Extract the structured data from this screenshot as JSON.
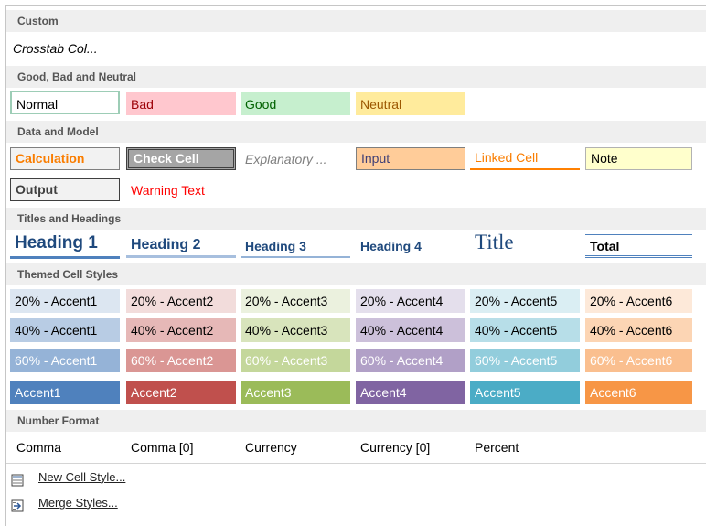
{
  "sections": {
    "custom": "Custom",
    "good_bad_neutral": "Good, Bad and Neutral",
    "data_model": "Data and Model",
    "titles_headings": "Titles and Headings",
    "themed": "Themed Cell Styles",
    "number_format": "Number Format"
  },
  "custom": {
    "crosstab": "Crosstab Col..."
  },
  "gbn": {
    "normal": "Normal",
    "bad": "Bad",
    "good": "Good",
    "neutral": "Neutral"
  },
  "data_model": {
    "calculation": "Calculation",
    "check_cell": "Check Cell",
    "explanatory": "Explanatory ...",
    "input": "Input",
    "linked_cell": "Linked Cell",
    "note": "Note",
    "output": "Output",
    "warning_text": "Warning Text"
  },
  "titles": {
    "heading1": "Heading 1",
    "heading2": "Heading 2",
    "heading3": "Heading 3",
    "heading4": "Heading 4",
    "title": "Title",
    "total": "Total"
  },
  "themed": {
    "r20": [
      "20% - Accent1",
      "20% - Accent2",
      "20% - Accent3",
      "20% - Accent4",
      "20% - Accent5",
      "20% - Accent6"
    ],
    "r40": [
      "40% - Accent1",
      "40% - Accent2",
      "40% - Accent3",
      "40% - Accent4",
      "40% - Accent5",
      "40% - Accent6"
    ],
    "r60": [
      "60% - Accent1",
      "60% - Accent2",
      "60% - Accent3",
      "60% - Accent4",
      "60% - Accent5",
      "60% - Accent6"
    ],
    "accent": [
      "Accent1",
      "Accent2",
      "Accent3",
      "Accent4",
      "Accent5",
      "Accent6"
    ]
  },
  "number_format": {
    "comma": "Comma",
    "comma0": "Comma [0]",
    "currency": "Currency",
    "currency0": "Currency [0]",
    "percent": "Percent"
  },
  "footer": {
    "new_style": "New Cell Style...",
    "merge_styles": "Merge Styles..."
  },
  "colors": {
    "accent1": "#4f81bd",
    "accent2": "#c0504d",
    "accent3": "#9bbb59",
    "accent4": "#8064a2",
    "accent5": "#4bacc6",
    "accent6": "#f79646"
  },
  "icons": {
    "new_style": "cell-style-icon",
    "merge_styles": "merge-styles-icon"
  }
}
